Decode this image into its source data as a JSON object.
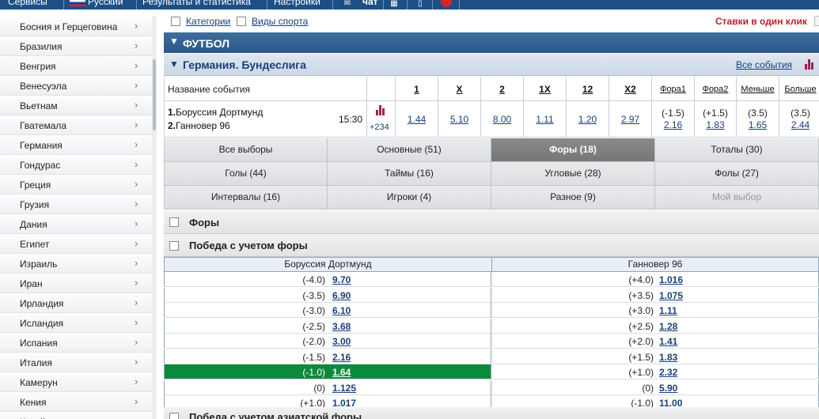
{
  "topbar": {
    "services": "Сервисы",
    "language": "Русский",
    "results": "Результаты и статистика",
    "settings": "Настройки",
    "chat": "чат"
  },
  "sidebar": {
    "countries": [
      "Босния и Герцеговина",
      "Бразилия",
      "Венгрия",
      "Венесуэла",
      "Вьетнам",
      "Гватемала",
      "Германия",
      "Гондурас",
      "Греция",
      "Грузия",
      "Дания",
      "Египет",
      "Израиль",
      "Иран",
      "Ирландия",
      "Исландия",
      "Испания",
      "Италия",
      "Камерун",
      "Кения",
      "Китай"
    ]
  },
  "filters": {
    "categories": "Категории",
    "sports": "Виды спорта",
    "one_click": "Ставки в один клик"
  },
  "sport": {
    "title": "ФУТБОЛ"
  },
  "league": {
    "title": "Германия. Бундеслига",
    "all_events": "Все события"
  },
  "odds_table": {
    "event_header": "Название события",
    "columns": [
      "1",
      "X",
      "2",
      "1X",
      "12",
      "X2"
    ],
    "extra_columns": [
      "Фора1",
      "Фора2",
      "Меньше",
      "Больше"
    ],
    "event": {
      "team1_num": "1.",
      "team1": "Боруссия Дортмунд",
      "team2_num": "2.",
      "team2": "Ганновер 96",
      "time": "15:30",
      "more": "+234",
      "odds": [
        "1.44",
        "5.10",
        "8.00",
        "1.11",
        "1.20",
        "2.97"
      ],
      "handicaps": [
        {
          "line": "(-1.5)",
          "odd": "2.16"
        },
        {
          "line": "(+1.5)",
          "odd": "1.83"
        },
        {
          "line": "(3.5)",
          "odd": "1.65"
        },
        {
          "line": "(3.5)",
          "odd": "2.44"
        }
      ]
    }
  },
  "tabs": [
    [
      "Все выборы",
      "Основные (51)",
      "Форы (18)",
      "Тоталы (30)"
    ],
    [
      "Голы (44)",
      "Таймы (16)",
      "Угловые (28)",
      "Фолы (27)"
    ],
    [
      "Интервалы (16)",
      "Игроки (4)",
      "Разное (9)",
      "Мой выбор"
    ]
  ],
  "active_tab": "Форы (18)",
  "sections": {
    "handicaps": "Форы",
    "win_handicap": "Победа с учетом форы",
    "asian": "Победа с учетом азиатской форы"
  },
  "handicap_table": {
    "team1": "Боруссия Дортмунд",
    "team2": "Ганновер 96",
    "rows": [
      {
        "l_line": "(-4.0)",
        "l_odd": "9.70",
        "r_line": "(+4.0)",
        "r_odd": "1.016"
      },
      {
        "l_line": "(-3.5)",
        "l_odd": "6.90",
        "r_line": "(+3.5)",
        "r_odd": "1.075"
      },
      {
        "l_line": "(-3.0)",
        "l_odd": "6.10",
        "r_line": "(+3.0)",
        "r_odd": "1.11"
      },
      {
        "l_line": "(-2.5)",
        "l_odd": "3.68",
        "r_line": "(+2.5)",
        "r_odd": "1.28"
      },
      {
        "l_line": "(-2.0)",
        "l_odd": "3.00",
        "r_line": "(+2.0)",
        "r_odd": "1.41"
      },
      {
        "l_line": "(-1.5)",
        "l_odd": "2.16",
        "r_line": "(+1.5)",
        "r_odd": "1.83"
      },
      {
        "l_line": "(-1.0)",
        "l_odd": "1.64",
        "r_line": "(+1.0)",
        "r_odd": "2.32",
        "selected": true
      },
      {
        "l_line": "(0)",
        "l_odd": "1.125",
        "r_line": "(0)",
        "r_odd": "5.90"
      },
      {
        "l_line": "(+1.0)",
        "l_odd": "1.017",
        "r_line": "(-1.0)",
        "r_odd": "11.00"
      }
    ]
  },
  "colors": {
    "nav": "#1d4f86",
    "selected": "#0c8a3c",
    "link": "#1b3f7b",
    "alert": "#c01f26"
  }
}
